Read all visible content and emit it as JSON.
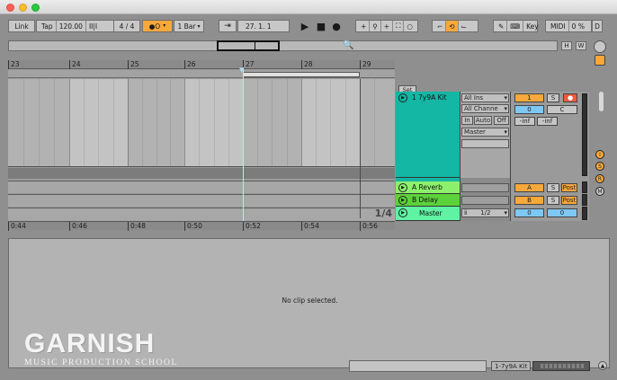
{
  "transport": {
    "link": "Link",
    "tap": "Tap",
    "tempo": "120.00",
    "metro_icon": "II|I",
    "time_sig": "4 / 4",
    "rec_mode": "●O",
    "quantize": "1 Bar",
    "position": "27.   1.   1",
    "play_icon": "play-icon",
    "stop_icon": "stop-icon",
    "record_icon": "record-icon",
    "key_label": "Key",
    "midi_label": "MIDI",
    "cpu": "0 %",
    "d_label": "D"
  },
  "overview": {
    "h_label": "H",
    "w_label": "W"
  },
  "ruler": {
    "bars": [
      "23",
      "24",
      "25",
      "26",
      "27",
      "28",
      "29"
    ]
  },
  "timeline": {
    "times": [
      "0:44",
      "0:46",
      "0:48",
      "0:50",
      "0:52",
      "0:54",
      "0:56"
    ]
  },
  "quantize_display": "1/4",
  "set_label": "Set",
  "tracks": {
    "kit": {
      "name": "1 7y9A Kit",
      "input_type": "All Ins",
      "input_channel": "All Channe",
      "monitor_in": "In",
      "monitor_auto": "Auto",
      "monitor_off": "Off",
      "output": "Master",
      "number": "1",
      "solo": "S",
      "volume": "0",
      "pan": "C",
      "peak_left": "-inf",
      "peak_right": "-inf"
    },
    "reverb": {
      "name": "A Reverb",
      "letter": "A",
      "solo": "S",
      "post": "Post"
    },
    "delay": {
      "name": "B Delay",
      "letter": "B",
      "solo": "S",
      "post": "Post"
    },
    "master": {
      "name": "Master",
      "cue": "1/2",
      "volume": "0",
      "pan": "0"
    }
  },
  "detail": {
    "no_clip": "No clip selected."
  },
  "status": {
    "track_name": "1-7y9A Kit"
  },
  "logo": {
    "word": "GARNISH",
    "sub": "MUSIC PRODUCTION SCHOOL"
  },
  "colors": {
    "accent": "#f6a83a",
    "kit_track": "#13b7a4",
    "return_green": "#8df06d",
    "master_green": "#5ff3a3",
    "blue": "#7ec8f5"
  }
}
